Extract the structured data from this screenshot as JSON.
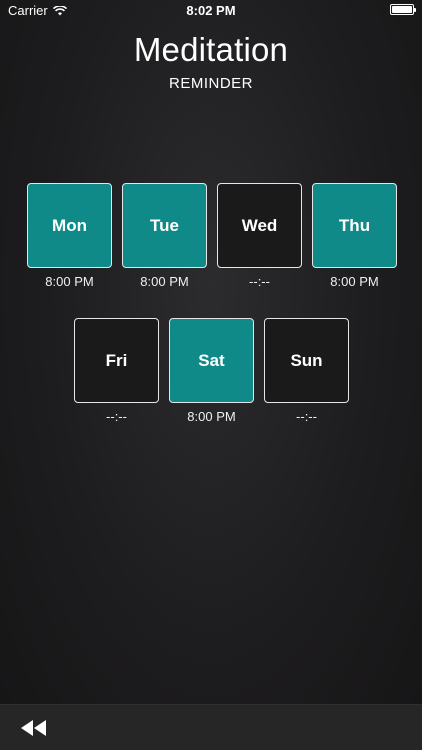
{
  "status_bar": {
    "carrier": "Carrier",
    "time": "8:02 PM",
    "wifi_icon": "wifi-icon",
    "battery_icon": "battery-icon"
  },
  "header": {
    "title": "Meditation",
    "subtitle": "REMINDER"
  },
  "days": [
    {
      "label": "Mon",
      "time": "8:00 PM",
      "active": true
    },
    {
      "label": "Tue",
      "time": "8:00 PM",
      "active": true
    },
    {
      "label": "Wed",
      "time": "--:--",
      "active": false
    },
    {
      "label": "Thu",
      "time": "8:00 PM",
      "active": true
    },
    {
      "label": "Fri",
      "time": "--:--",
      "active": false
    },
    {
      "label": "Sat",
      "time": "8:00 PM",
      "active": true
    },
    {
      "label": "Sun",
      "time": "--:--",
      "active": false
    }
  ],
  "bottom_bar": {
    "back_icon": "rewind-icon"
  },
  "colors": {
    "active_tile": "#0f8a89",
    "inactive_tile": "#1a1a1b",
    "background": "#1d1c1e"
  }
}
